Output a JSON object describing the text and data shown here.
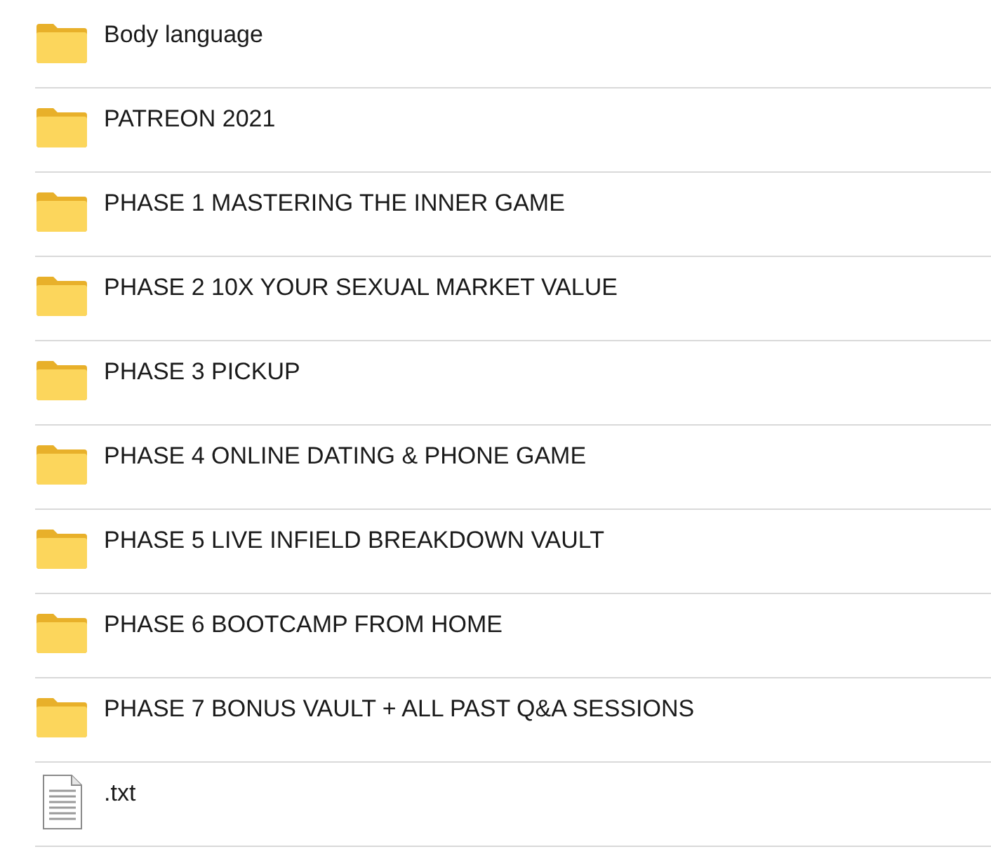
{
  "items": [
    {
      "kind": "folder",
      "name": "Body language"
    },
    {
      "kind": "folder",
      "name": "PATREON 2021"
    },
    {
      "kind": "folder",
      "name": "PHASE 1 MASTERING THE INNER GAME"
    },
    {
      "kind": "folder",
      "name": "PHASE 2 10X YOUR SEXUAL MARKET VALUE"
    },
    {
      "kind": "folder",
      "name": "PHASE 3 PICKUP"
    },
    {
      "kind": "folder",
      "name": "PHASE 4 ONLINE DATING & PHONE GAME"
    },
    {
      "kind": "folder",
      "name": "PHASE 5 LIVE INFIELD BREAKDOWN VAULT"
    },
    {
      "kind": "folder",
      "name": "PHASE 6 BOOTCAMP FROM HOME"
    },
    {
      "kind": "folder",
      "name": "PHASE 7 BONUS VAULT + ALL PAST Q&A SESSIONS"
    },
    {
      "kind": "file",
      "name": ".txt"
    }
  ]
}
